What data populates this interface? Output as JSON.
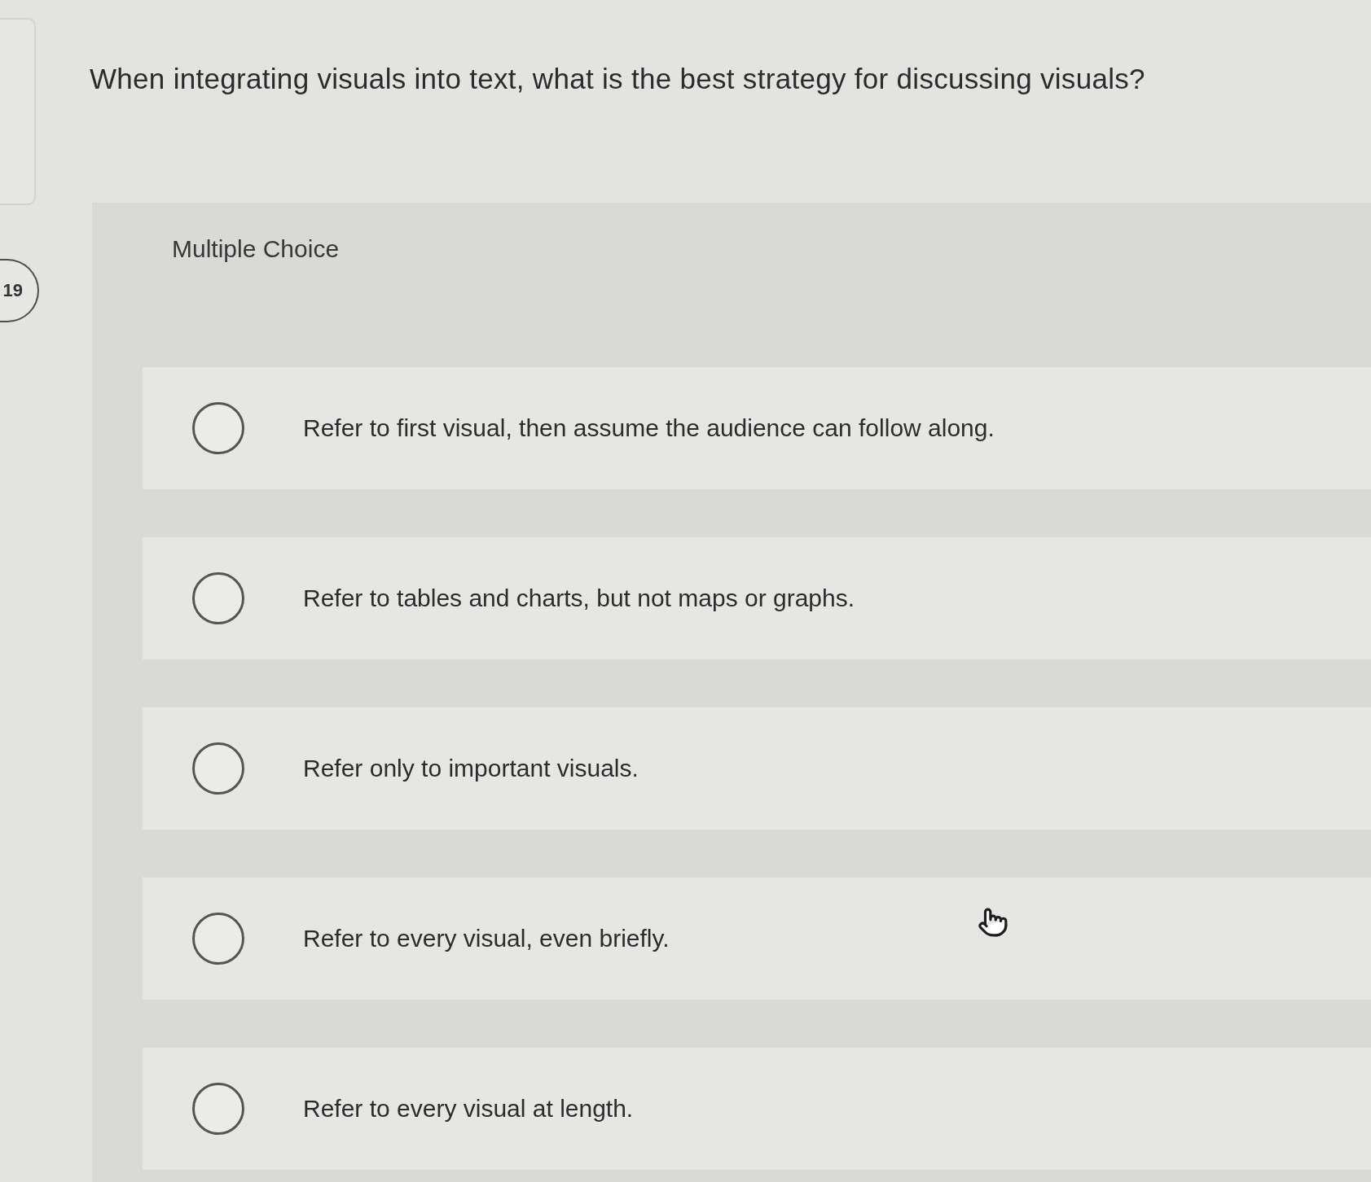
{
  "question": {
    "number": "19",
    "text": "When integrating visuals into text, what is the best strategy for discussing visuals?"
  },
  "answer_panel": {
    "type_label": "Multiple Choice",
    "options": [
      {
        "label": "Refer to first visual, then assume the audience can follow along.",
        "selected": false
      },
      {
        "label": "Refer to tables and charts, but not maps or graphs.",
        "selected": false
      },
      {
        "label": "Refer only to important visuals.",
        "selected": false
      },
      {
        "label": "Refer to every visual, even briefly.",
        "selected": false
      },
      {
        "label": "Refer to every visual at length.",
        "selected": false
      }
    ]
  }
}
